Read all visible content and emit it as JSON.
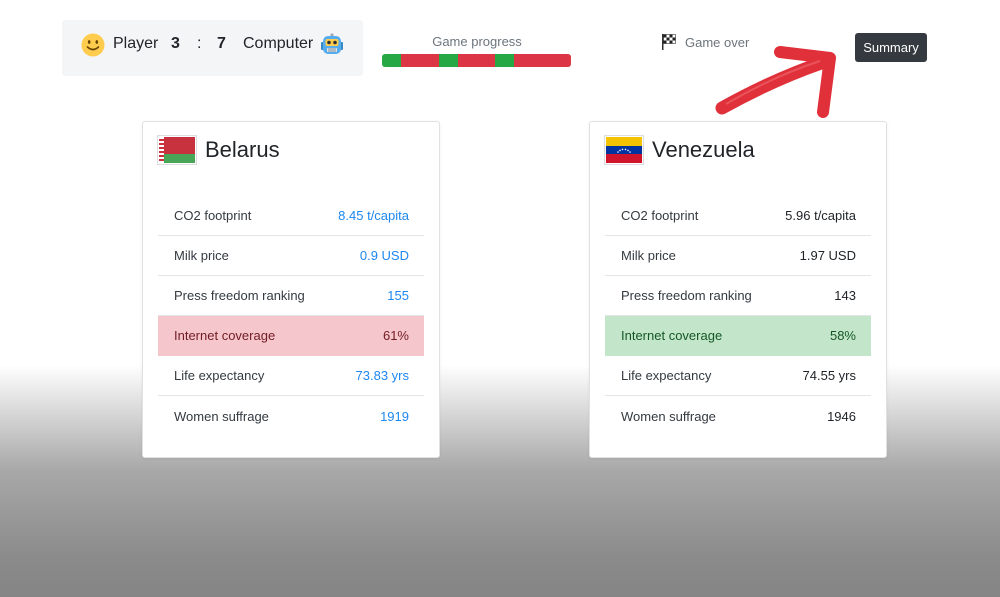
{
  "scoreboard": {
    "player_label": "Player",
    "player_score": "3",
    "separator": ":",
    "computer_score": "7",
    "computer_label": "Computer",
    "player_icon": "smiley-face-icon",
    "computer_icon": "robot-icon"
  },
  "progress": {
    "label": "Game progress",
    "segments": [
      "green",
      "red",
      "red",
      "green",
      "red",
      "red",
      "green",
      "red",
      "red",
      "red"
    ],
    "colors": {
      "green": "#28a745",
      "red": "#dc3545"
    }
  },
  "status": {
    "label": "Game over",
    "icon": "checkered-flag-icon"
  },
  "summary_button": {
    "label": "Summary"
  },
  "annotation": {
    "icon": "red-arrow-pointing-to-summary"
  },
  "cards": [
    {
      "country": "Belarus",
      "flag_icon": "belarus-flag-icon",
      "rows": [
        {
          "label": "CO2 footprint",
          "value": "8.45 t/capita",
          "state": ""
        },
        {
          "label": "Milk price",
          "value": "0.9 USD",
          "state": ""
        },
        {
          "label": "Press freedom ranking",
          "value": "155",
          "state": ""
        },
        {
          "label": "Internet coverage",
          "value": "61%",
          "state": "lose"
        },
        {
          "label": "Life expectancy",
          "value": "73.83 yrs",
          "state": ""
        },
        {
          "label": "Women suffrage",
          "value": "1919",
          "state": ""
        }
      ]
    },
    {
      "country": "Venezuela",
      "flag_icon": "venezuela-flag-icon",
      "rows": [
        {
          "label": "CO2 footprint",
          "value": "5.96 t/capita",
          "state": ""
        },
        {
          "label": "Milk price",
          "value": "1.97 USD",
          "state": ""
        },
        {
          "label": "Press freedom ranking",
          "value": "143",
          "state": ""
        },
        {
          "label": "Internet coverage",
          "value": "58%",
          "state": "win"
        },
        {
          "label": "Life expectancy",
          "value": "74.55 yrs",
          "state": ""
        },
        {
          "label": "Women suffrage",
          "value": "1946",
          "state": ""
        }
      ]
    }
  ]
}
